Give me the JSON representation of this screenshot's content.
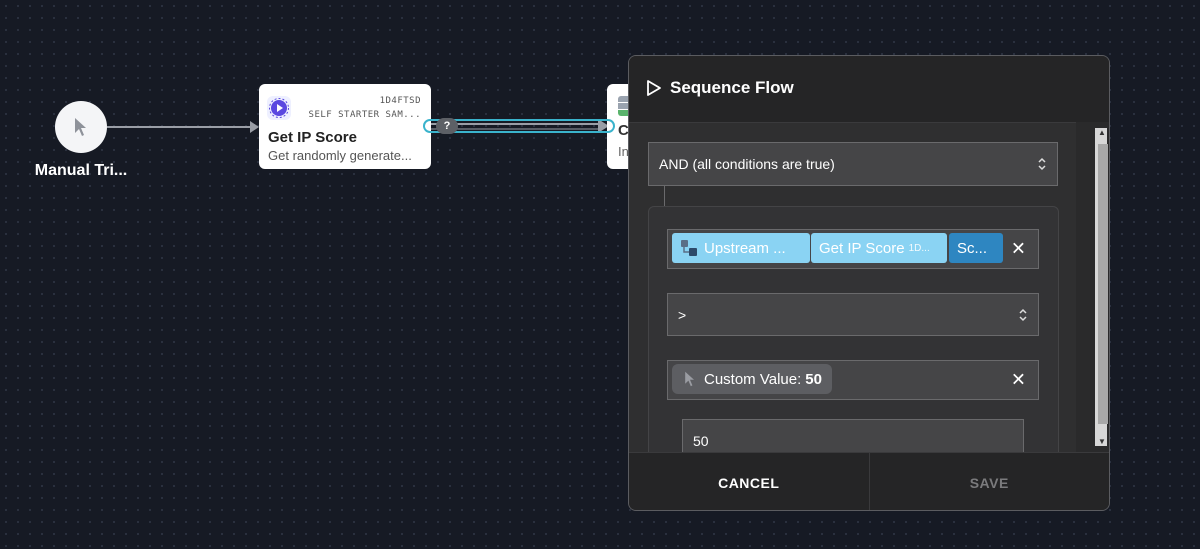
{
  "canvas": {
    "trigger": {
      "label": "Manual Tri..."
    },
    "action_card": {
      "id": "1D4FTSD",
      "subtitle": "SELF STARTER SAM...",
      "title": "Get IP Score",
      "description": "Get randomly generate..."
    },
    "next_card": {
      "title": "C",
      "description": "In"
    },
    "connection": {
      "badge": "?"
    }
  },
  "panel": {
    "title": "Sequence Flow",
    "logic_select": {
      "value": "AND (all conditions are true)"
    },
    "condition": {
      "left_operand": {
        "pills": [
          {
            "label": "Upstream ..."
          },
          {
            "label": "Get IP Score",
            "suffix": "1D..."
          },
          {
            "label": "Sc..."
          }
        ]
      },
      "operator_select": {
        "value": ">"
      },
      "right_operand": {
        "label": "Custom Value:",
        "value": "50"
      },
      "value_input": {
        "value": "50"
      }
    },
    "footer": {
      "cancel_label": "CANCEL",
      "save_label": "SAVE"
    }
  },
  "colors": {
    "canvas_bg": "#161a24",
    "panel_bg": "#2f2f30",
    "pill_light": "#8ad3f3",
    "pill_dark": "#2e86c1",
    "connection_highlight": "#3ab3cc"
  }
}
